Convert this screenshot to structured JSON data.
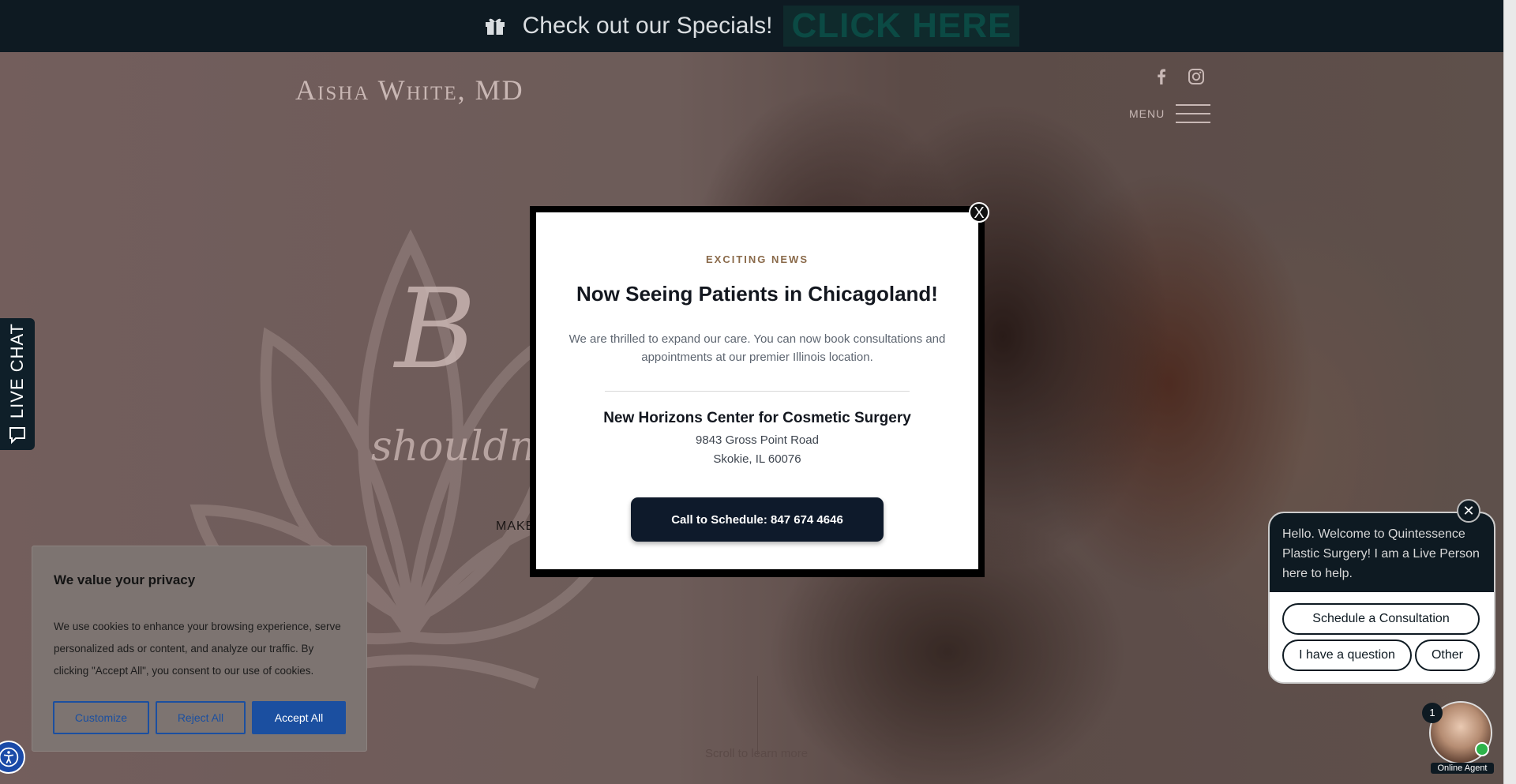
{
  "banner": {
    "text": "Check out our Specials!",
    "link": "CLICK HERE"
  },
  "header": {
    "logo": "Aisha White, MD",
    "menu_label": "MENU"
  },
  "hero": {
    "script_big": "B",
    "script_small": "shouldn't",
    "make": "MAKE",
    "scroll": "Scroll to learn more"
  },
  "live_chat_tab": "LIVE CHAT",
  "modal": {
    "kicker": "EXCITING NEWS",
    "title": "Now Seeing Patients in Chicagoland!",
    "description": "We are thrilled to expand our care. You can now book consultations and appointments at our premier Illinois location.",
    "center_name": "New Horizons Center for Cosmetic Surgery",
    "address_line1": "9843 Gross Point Road",
    "address_line2": "Skokie, IL 60076",
    "cta": "Call to Schedule: 847 674 4646",
    "close": "X"
  },
  "cookie": {
    "title": "We value your privacy",
    "body": "We use cookies to enhance your browsing experience, serve personalized ads or content, and analyze our traffic. By clicking \"Accept All\", you consent to our use of cookies.",
    "customize": "Customize",
    "reject": "Reject All",
    "accept": "Accept All"
  },
  "chat": {
    "message": "Hello. Welcome to Quintessence Plastic Surgery! I am a Live Person here to help.",
    "options": [
      "Schedule a Consultation",
      "I have a question",
      "Other"
    ],
    "badge": "1",
    "agent_label": "Online Agent",
    "close": "✕"
  },
  "colors": {
    "navy": "#0e1a22",
    "cookie_blue": "#1b4fa0",
    "kicker": "#8a6a4a"
  }
}
